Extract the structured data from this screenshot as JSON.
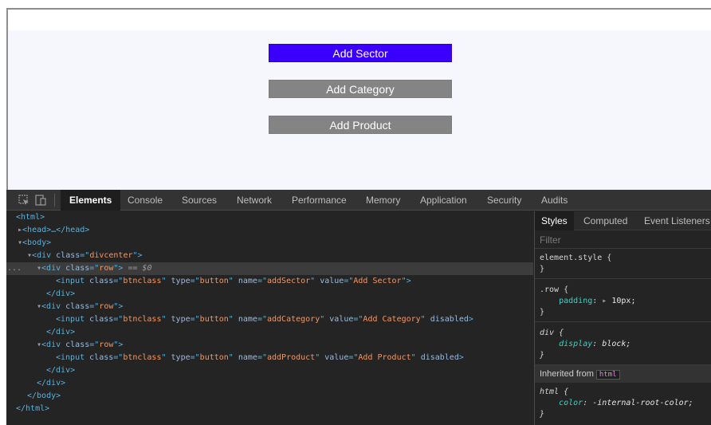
{
  "page": {
    "buttons": [
      {
        "label": "Add Sector",
        "state": "enabled"
      },
      {
        "label": "Add Category",
        "state": "disabled"
      },
      {
        "label": "Add Product",
        "state": "disabled"
      }
    ]
  },
  "devtools": {
    "tabs": [
      "Elements",
      "Console",
      "Sources",
      "Network",
      "Performance",
      "Memory",
      "Application",
      "Security",
      "Audits"
    ],
    "active_tab": "Elements",
    "dom": {
      "html_open": "<html>",
      "head": "<head>…</head>",
      "body_open": "<body>",
      "div_center_tag": "div",
      "div_center_class": "divcenter",
      "row_class": "row",
      "selected_marker": "== $0",
      "ellipsis": "...",
      "inputs": [
        {
          "class": "btnclass",
          "type": "button",
          "name": "addSector",
          "value": "Add Sector",
          "disabled": ""
        },
        {
          "class": "btnclass",
          "type": "button",
          "name": "addCategory",
          "value": "Add Category",
          "disabled": "disabled"
        },
        {
          "class": "btnclass",
          "type": "button",
          "name": "addProduct",
          "value": "Add Product",
          "disabled": "disabled"
        }
      ],
      "div_close": "</div>",
      "body_close": "</body>",
      "html_close": "</html>"
    },
    "styles": {
      "tabs": [
        "Styles",
        "Computed",
        "Event Listeners"
      ],
      "active_tab": "Styles",
      "filter_placeholder": "Filter",
      "element_style": "element.style {",
      "close_brace": "}",
      "row_rule": {
        "selector": ".row {",
        "prop": "padding",
        "value": "10px;"
      },
      "div_rule": {
        "selector": "div {",
        "prop": "display",
        "value": "block;"
      },
      "inherited_label": "Inherited from",
      "inherited_tag": "html",
      "html_rule": {
        "selector": "html {",
        "prop": "color",
        "value": "-internal-root-color;"
      }
    }
  }
}
